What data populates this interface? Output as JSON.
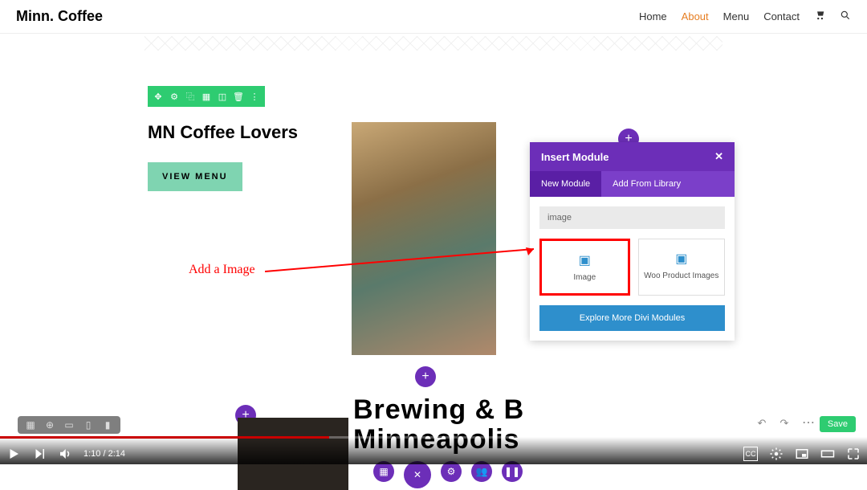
{
  "header": {
    "logo": "Minn. Coffee",
    "nav": [
      "Home",
      "About",
      "Menu",
      "Contact"
    ],
    "active_index": 1
  },
  "page": {
    "heading": "MN Coffee Lovers",
    "button": "VIEW MENU",
    "hero_line1": "Brewing & B",
    "hero_line2": "Minneapolis"
  },
  "modal": {
    "title": "Insert Module",
    "tabs": [
      "New Module",
      "Add From Library"
    ],
    "search": "image",
    "modules": [
      {
        "label": "Image"
      },
      {
        "label": "Woo Product Images"
      }
    ],
    "explore": "Explore More Divi Modules"
  },
  "annotation": {
    "text": "Add a Image"
  },
  "video": {
    "current": "1:10",
    "duration": "2:14"
  },
  "builder": {
    "save": "Save"
  }
}
